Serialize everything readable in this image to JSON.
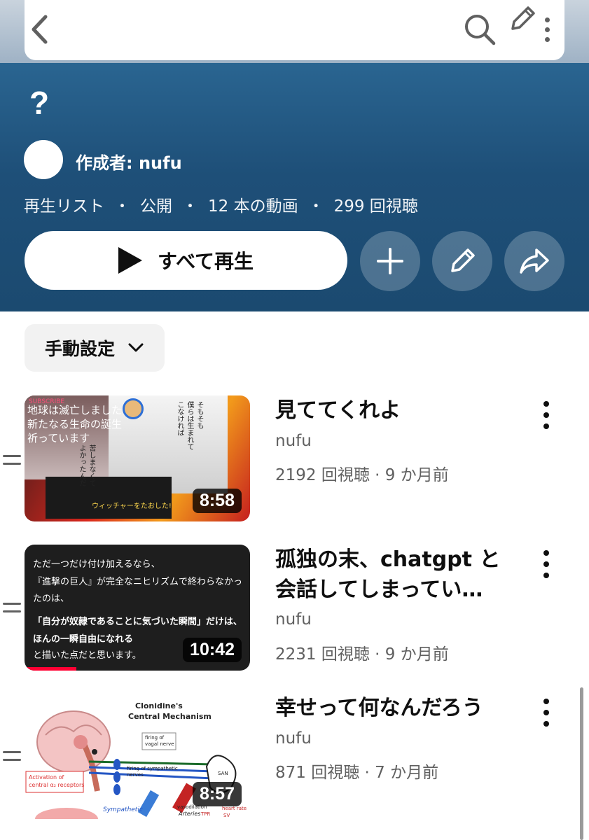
{
  "topbar": {
    "back_icon": "chevron-left-icon",
    "search_icon": "search-icon",
    "edit_icon": "pencil-icon",
    "more_icon": "more-vertical-icon"
  },
  "playlist": {
    "title": "?",
    "creator": "作成者: nufu",
    "meta": [
      "再生リスト",
      "・",
      "公開",
      "・",
      "12 本の動画",
      "・",
      "299 回視聴"
    ],
    "play_all_label": "すべて再生",
    "actions": [
      "add-icon",
      "pencil-icon",
      "share-icon"
    ],
    "header_color": "#1e4f78"
  },
  "sort": {
    "label": "手動設定",
    "icon": "chevron-down-icon"
  },
  "videos": [
    {
      "title": "見ててくれよ",
      "channel": "nufu",
      "stats": "2192 回視聴 · 9 か月前",
      "duration": "8:58",
      "thumb_texts": [
        "SUBSCRIBE",
        "地球は滅亡しました",
        "新たなる生命の誕生",
        "祈っています",
        "そもそも",
        "僕らは生まれて",
        "こなければ",
        "苦しまなくて",
        "よかったんだ",
        "ウィッチャーをたおした!"
      ],
      "progress": 0
    },
    {
      "title": "孤独の末、chatgpt と会話してしまってい…",
      "channel": "nufu",
      "stats": "2231 回視聴 · 9 か月前",
      "duration": "10:42",
      "thumb_texts": [
        "ただ一つだけ付け加えるなら、",
        "『進撃の巨人』が完全なニヒリズムで終わらなかっ",
        "たのは、",
        "「自分が奴隷であることに気づいた瞬間」だけは、",
        "ほんの一瞬自由になれる",
        "と描いた点だと思います。"
      ],
      "progress": 0.23
    },
    {
      "title": "幸せって何なんだろう",
      "channel": "nufu",
      "stats": "871 回視聴 · 7 か月前",
      "duration": "8:57",
      "thumb_texts": [
        "Clonidine's",
        "Central Mechanism",
        "firing of",
        "vagal nerve",
        "firing of sympathetic",
        "nerves",
        "Activation of",
        "central α₂ receptors",
        "SAN",
        "Sympathetic",
        "vasodilation",
        "Arteries",
        "TPR",
        "heart rate",
        "SV"
      ],
      "progress": 0
    }
  ],
  "colors": {
    "accent": "#ff0033",
    "secondary_text": "#606060"
  }
}
